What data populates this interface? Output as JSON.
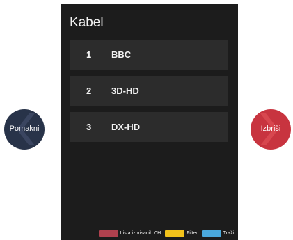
{
  "panel": {
    "title": "Kabel",
    "channels": [
      {
        "number": "1",
        "name": "BBC"
      },
      {
        "number": "2",
        "name": "3D-HD"
      },
      {
        "number": "3",
        "name": "DX-HD"
      }
    ]
  },
  "legend": [
    {
      "label": "Lista izbrisanih CH",
      "color": "#b0414e"
    },
    {
      "label": "Filter",
      "color": "#f2c21b"
    },
    {
      "label": "Traži",
      "color": "#4aa8dc"
    }
  ],
  "buttons": {
    "move": {
      "label": "Pomakni",
      "color": "#283349",
      "icon": "chevron-left-icon"
    },
    "delete": {
      "label": "Izbriši",
      "color": "#c8343f",
      "icon": "chevron-right-icon"
    }
  }
}
